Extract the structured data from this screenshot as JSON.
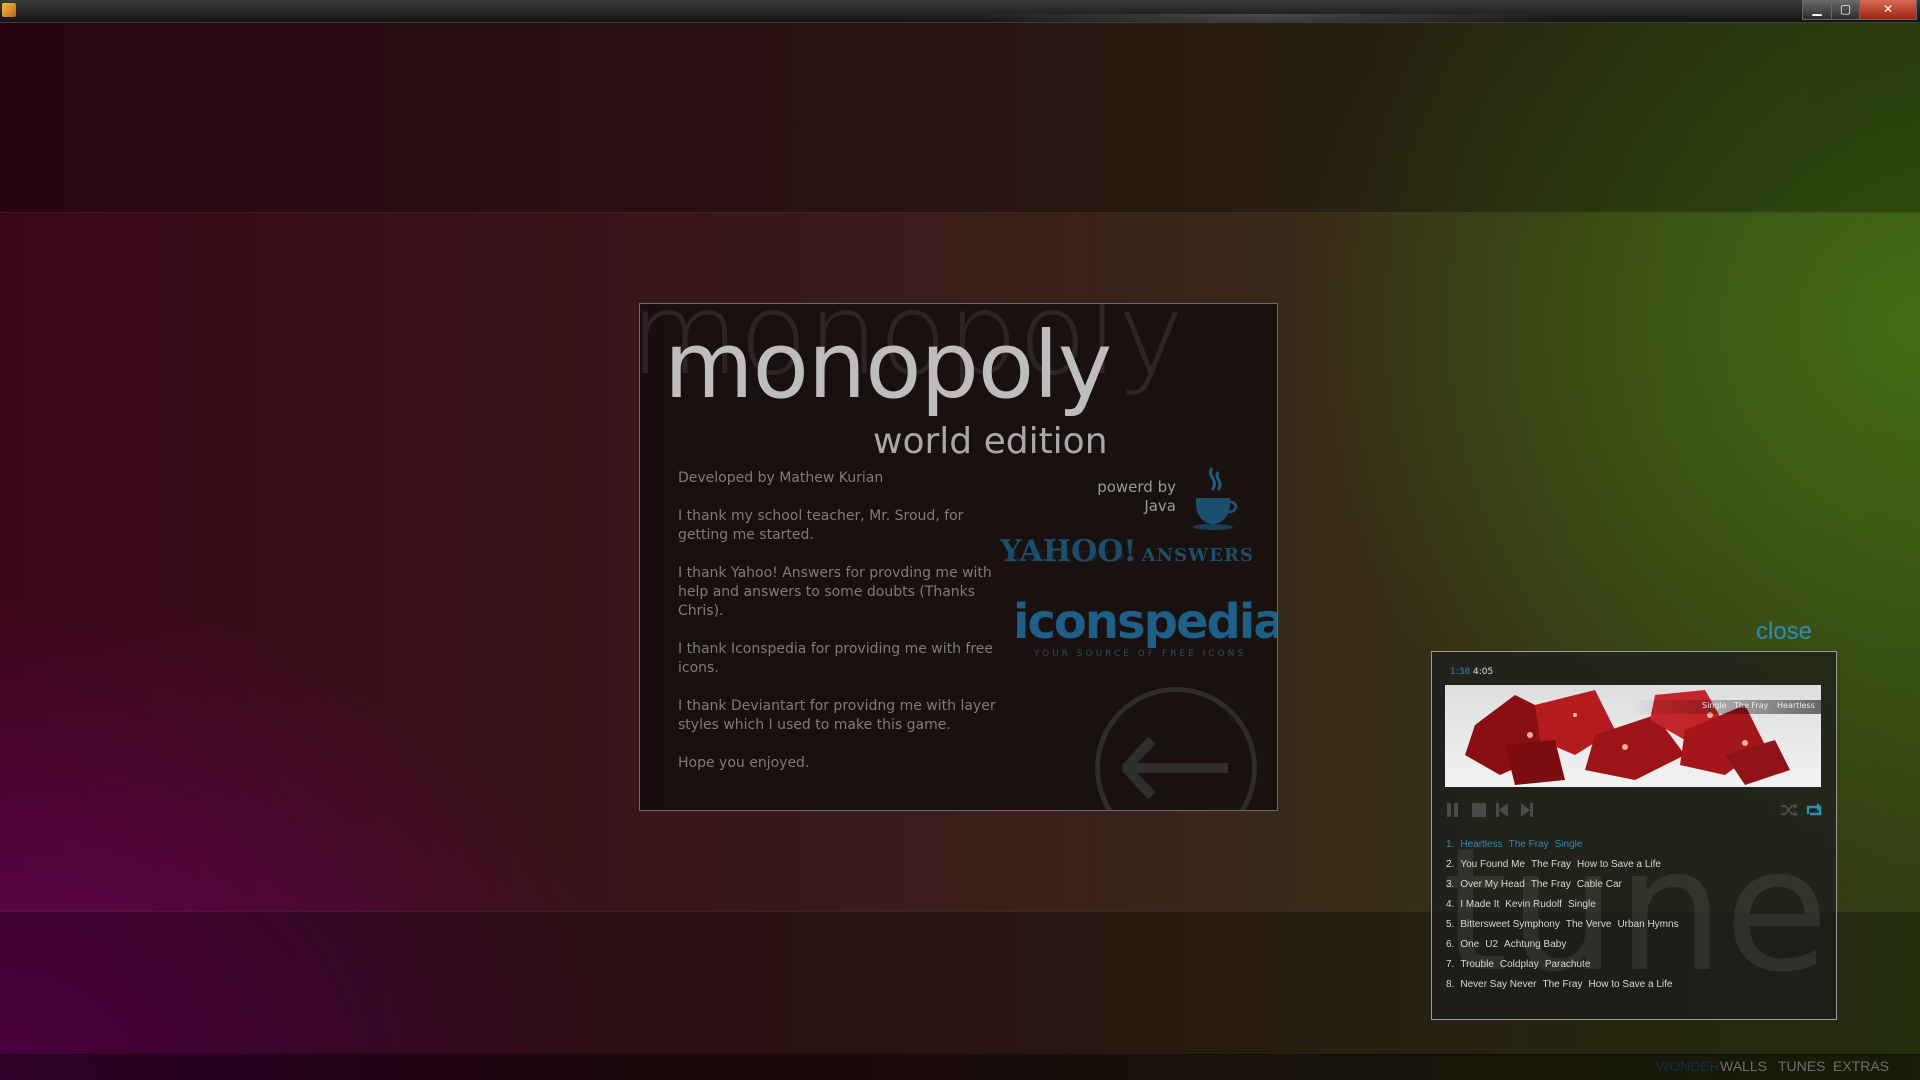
{
  "window": {
    "minimize": "▁",
    "maximize": "▢",
    "close": "✕"
  },
  "about": {
    "ghost_title": "monopoly",
    "title": "monopoly",
    "subtitle": "world edition",
    "credits": [
      "Developed by Mathew Kurian",
      "I thank my school teacher, Mr. Sroud, for getting me started.",
      "I thank Yahoo! Answers for provding me with help and answers to some doubts (Thanks Chris).",
      "I thank Iconspedia for providing me with free icons.",
      "I thank Deviantart for providng me with layer styles which I used to make this game.",
      "Hope you enjoyed."
    ],
    "powered_by": "powerd by",
    "powered_name": "Java",
    "yahoo_main": "YAHOO!",
    "yahoo_sub": "ANSWERS",
    "iconspedia_name": "iconspedia",
    "iconspedia_tagline": "YOUR SOURCE OF FREE ICONS",
    "icons": {
      "java": "java-cup-icon",
      "back": "back-arrow-icon"
    }
  },
  "tunes": {
    "close_label": "close",
    "ghost_label": "tunes",
    "current_time": "1:38",
    "total_time": "4:05",
    "progress": 0.4,
    "now_playing": {
      "album": "Single",
      "artist": "The Fray",
      "title": "Heartless"
    },
    "controls": [
      "pause-icon",
      "stop-icon",
      "previous-icon",
      "next-icon",
      "shuffle-icon",
      "repeat-icon"
    ],
    "tracks": [
      {
        "num": "1.",
        "title": "Heartless",
        "artist": "The Fray",
        "album": "Single"
      },
      {
        "num": "2.",
        "title": "You Found Me",
        "artist": "The Fray",
        "album": "How to Save a Life"
      },
      {
        "num": "3.",
        "title": "Over My Head",
        "artist": "The Fray",
        "album": "Cable Car"
      },
      {
        "num": "4.",
        "title": "I Made It",
        "artist": "Kevin Rudolf",
        "album": "Single"
      },
      {
        "num": "5.",
        "title": "Bittersweet Symphony",
        "artist": "The Verve",
        "album": "Urban Hymns"
      },
      {
        "num": "6.",
        "title": "One",
        "artist": "U2",
        "album": "Achtung Baby"
      },
      {
        "num": "7.",
        "title": "Trouble",
        "artist": "Coldplay",
        "album": "Parachute"
      },
      {
        "num": "8.",
        "title": "Never Say Never",
        "artist": "The Fray",
        "album": "How to Save a Life"
      }
    ]
  },
  "nav": {
    "items": [
      "WONDER",
      "WALLS",
      "TUNES",
      "EXTRAS"
    ],
    "active": "WONDER"
  },
  "colors": {
    "accent": "#2a8fb8",
    "active_nav": "#0f2f4a"
  }
}
